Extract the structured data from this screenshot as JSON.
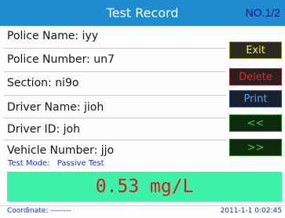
{
  "header": {
    "title": "Test Record",
    "page_indicator": "NO.1/2"
  },
  "record": {
    "fields": [
      {
        "label": "Police Name:",
        "value": "iyy"
      },
      {
        "label": "Police Number:",
        "value": "un7"
      },
      {
        "label": "Section:",
        "value": "ni9o"
      },
      {
        "label": "Driver Name:",
        "value": "jioh"
      },
      {
        "label": "Driver ID:",
        "value": "joh"
      },
      {
        "label": "Vehicle Number:",
        "value": "jjo"
      }
    ],
    "test_mode_label": "Test Mode:",
    "test_mode_value": "Passive Test"
  },
  "buttons": {
    "exit": "Exit",
    "delete": "Delete",
    "print": "Print",
    "prev": "<<",
    "next": ">>"
  },
  "result": {
    "text": "0.53 mg/L"
  },
  "footer": {
    "coordinate_label": "Coordinate:",
    "coordinate_value": "--------",
    "datetime": "2011-1-1 0:02:45"
  },
  "colors": {
    "title_bar": "#1f8ccf",
    "result_bar": "#3cf2a8",
    "result_text": "#d41c1c"
  }
}
